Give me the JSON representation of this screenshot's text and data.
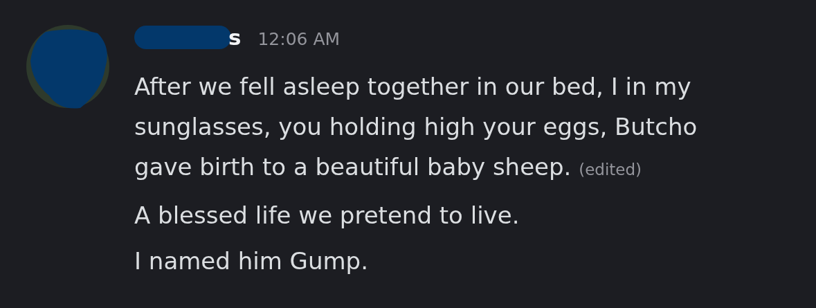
{
  "message": {
    "author": {
      "name_visible": "s",
      "redacted": true
    },
    "timestamp": "12:06 AM",
    "lines": [
      {
        "text": "After we fell asleep together in our bed, I in my sunglasses, you holding high your eggs, Butcho gave birth to a beautiful baby sheep.",
        "edited": true,
        "edited_label": "(edited)"
      },
      {
        "text": "A blessed life we pretend to live.",
        "edited": false
      },
      {
        "text": "I named him Gump.",
        "edited": false
      }
    ]
  }
}
